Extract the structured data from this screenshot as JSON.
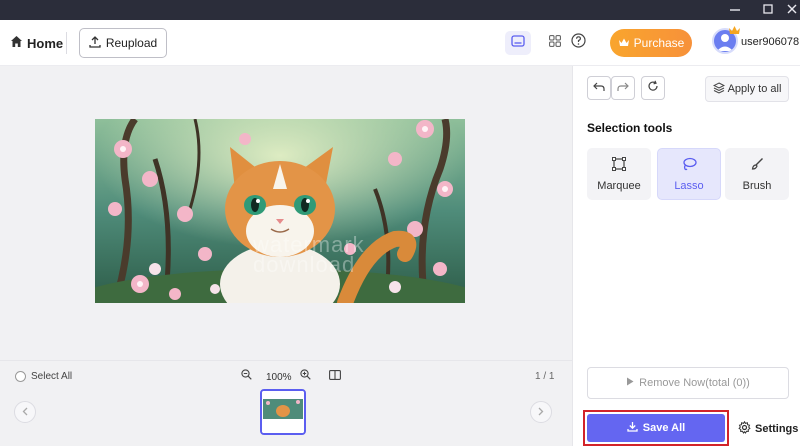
{
  "header": {
    "home_label": "Home",
    "reupload_label": "Reupload",
    "purchase_label": "Purchase",
    "username": "user906078"
  },
  "canvas": {
    "watermark_line1": "watermark",
    "watermark_line2": "download"
  },
  "bottom": {
    "select_all_label": "Select All",
    "zoom_level": "100%",
    "page_info": "1 / 1"
  },
  "panel": {
    "apply_to_all_label": "Apply to all",
    "section_title": "Selection tools",
    "tools": [
      {
        "label": "Marquee",
        "icon": "marquee-icon"
      },
      {
        "label": "Lasso",
        "icon": "lasso-icon"
      },
      {
        "label": "Brush",
        "icon": "brush-icon"
      }
    ],
    "active_tool": "Lasso",
    "remove_label": "Remove Now(total (0))",
    "save_label": "Save All",
    "settings_label": "Settings"
  },
  "colors": {
    "accent": "#6466f1",
    "purchase": "#f7913a",
    "highlight_border": "#d2232a"
  }
}
